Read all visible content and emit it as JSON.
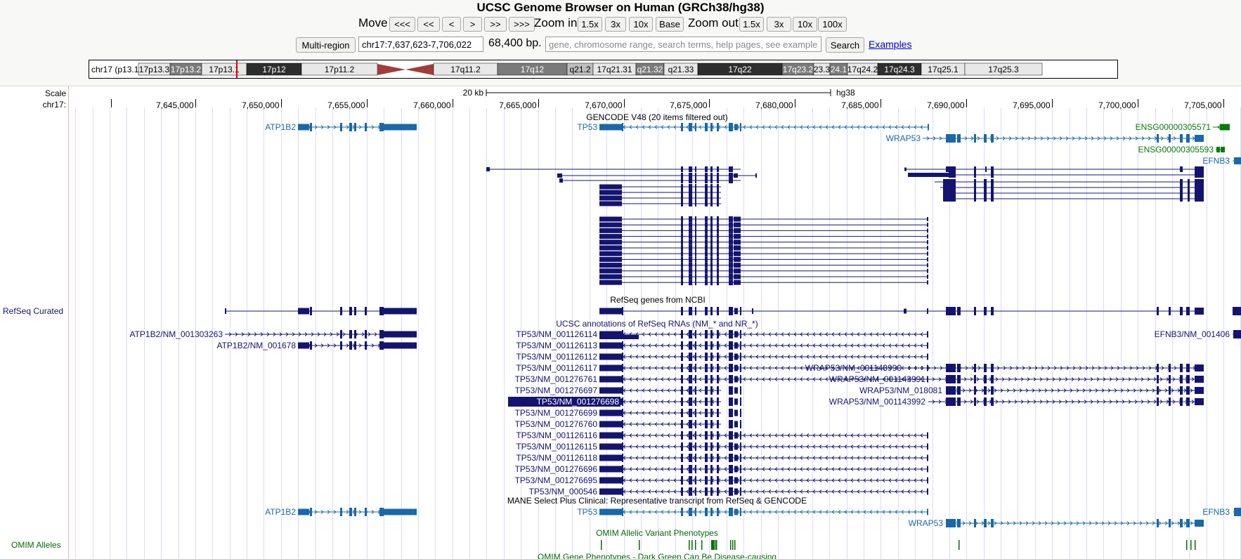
{
  "header": {
    "title": "UCSC Genome Browser on Human (GRCh38/hg38)"
  },
  "nav": {
    "move_label": "Move",
    "move_buttons": [
      "<<<",
      "<<",
      "<",
      ">",
      ">>",
      ">>>"
    ],
    "zoom_in_label": "Zoom in",
    "zoom_in_buttons": [
      "1.5x",
      "3x",
      "10x",
      "Base"
    ],
    "zoom_out_label": "Zoom out",
    "zoom_out_buttons": [
      "1.5x",
      "3x",
      "10x",
      "100x"
    ]
  },
  "position": {
    "multi_region_label": "Multi-region",
    "value": "chr17:7,637,623-7,706,022",
    "span": "68,400 bp.",
    "search_placeholder": "gene, chromosome range, search terms, help pages, see examples",
    "search_label": "Search",
    "examples_label": "Examples"
  },
  "ideogram": {
    "chrom_label": "chr17 (p13.1)",
    "bands": [
      {
        "name": "17p13.3",
        "stain": "light"
      },
      {
        "name": "17p13.2",
        "stain": "mid"
      },
      {
        "name": "17p13.1",
        "stain": "light"
      },
      {
        "name": "17p12",
        "stain": "dark"
      },
      {
        "name": "17p11.2",
        "stain": "light"
      },
      {
        "name": "",
        "stain": "centromere"
      },
      {
        "name": "17q11.2",
        "stain": "light"
      },
      {
        "name": "17q12",
        "stain": "mid"
      },
      {
        "name": "q21.2",
        "stain": "light-mid"
      },
      {
        "name": "17q21.31",
        "stain": "light"
      },
      {
        "name": "q21.32",
        "stain": "mid"
      },
      {
        "name": "q21.33",
        "stain": "light"
      },
      {
        "name": "17q22",
        "stain": "dark"
      },
      {
        "name": "17q23.2",
        "stain": "mid"
      },
      {
        "name": "23.3",
        "stain": "light"
      },
      {
        "name": "24.1",
        "stain": "mid"
      },
      {
        "name": "17q24.2",
        "stain": "light"
      },
      {
        "name": "17q24.3",
        "stain": "dark"
      },
      {
        "name": "17q25.1",
        "stain": "light"
      },
      {
        "name": "17q25.3",
        "stain": "light"
      }
    ],
    "colors": {
      "light": "#e8e8e8",
      "light-mid": "#bdbdbd",
      "mid": "#7a7a7a",
      "dark": "#2e2e2e",
      "centromere": "#a03c3c",
      "marker": "#ee0000"
    }
  },
  "ruler": {
    "scale_label": "Scale",
    "chrom_label": "chr17:",
    "scale_bar_text": "20 kb",
    "assembly": "hg38",
    "view_start": 7637623,
    "view_end": 7706022,
    "tick_labels": [
      "7,645,000",
      "7,650,000",
      "7,655,000",
      "7,660,000",
      "7,665,000",
      "7,670,000",
      "7,675,000",
      "7,680,000",
      "7,685,000",
      "7,690,000",
      "7,695,000",
      "7,700,000",
      "7,705,000"
    ],
    "tick_values": [
      7645000,
      7650000,
      7655000,
      7660000,
      7665000,
      7670000,
      7675000,
      7680000,
      7685000,
      7690000,
      7695000,
      7700000,
      7705000
    ]
  },
  "tracks": {
    "gencode": {
      "title": "GENCODE V48 (20 items filtered out)",
      "genes": [
        {
          "label": "ATP1B2",
          "color": "#1a68a8"
        },
        {
          "label": "TP53",
          "color": "#1a68a8"
        },
        {
          "label": "WRAP53",
          "color": "#1a68a8"
        },
        {
          "label": "ENSG00000305571",
          "color": "#0a7a0a"
        },
        {
          "label": "ENSG00000305593",
          "color": "#0a7a0a"
        },
        {
          "label": "EFNB3",
          "color": "#1a68a8"
        }
      ]
    },
    "refseq_curated": {
      "side_label": "RefSeq Curated",
      "title": "RefSeq genes from NCBI"
    },
    "ucsc_refseq": {
      "title": "UCSC annotations of RefSeq RNAs (NM_* and NR_*)",
      "left_labels": [
        "ATP1B2/NM_001303263",
        "ATP1B2/NM_001678"
      ],
      "tp53_labels": [
        "TP53/NM_001126114",
        "TP53/NM_001126113",
        "TP53/NM_001126112",
        "TP53/NM_001126117",
        "TP53/NM_001276761",
        "TP53/NM_001276697",
        "TP53/NM_001276698",
        "TP53/NM_001276699",
        "TP53/NM_001276760",
        "TP53/NM_001126116",
        "TP53/NM_001126115",
        "TP53/NM_001126118",
        "TP53/NM_001276696",
        "TP53/NM_001276695",
        "TP53/NM_000546"
      ],
      "selected_label": "TP53/NM_001276698",
      "wrap53_labels": [
        "WRAP53/NM_001143990",
        "WRAP53/NM_001143991",
        "WRAP53/NM_018081",
        "WRAP53/NM_001143992"
      ],
      "efnb3_label": "EFNB3/NM_001406",
      "color": "#141470"
    },
    "mane": {
      "title": "MANE Select Plus Clinical: Representative transcript from RefSeq & GENCODE",
      "labels": [
        "ATP1B2",
        "TP53",
        "WRAP53",
        "EFNB3"
      ]
    },
    "omim_alleles": {
      "side_label": "OMIM Alleles",
      "title": "OMIM Allelic Variant Phenotypes",
      "color": "#0a6a0a"
    },
    "omim_genes": {
      "title": "OMIM Gene Phenotypes - Dark Green Can Be Disease-causing"
    }
  }
}
